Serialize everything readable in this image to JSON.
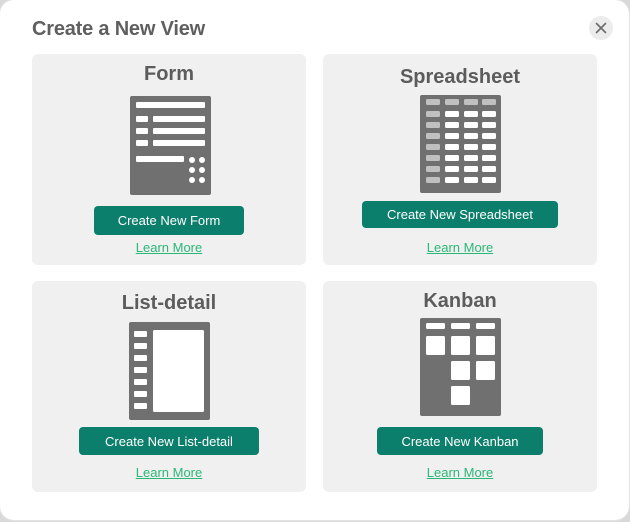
{
  "dialog": {
    "title": "Create a New View",
    "close_icon": "close-icon"
  },
  "cards": {
    "form": {
      "title": "Form",
      "button_label": "Create New Form",
      "learn_more": "Learn More",
      "icon": "form-illustration-icon"
    },
    "spreadsheet": {
      "title": "Spreadsheet",
      "button_label": "Create New Spreadsheet",
      "learn_more": "Learn More",
      "icon": "spreadsheet-illustration-icon"
    },
    "list_detail": {
      "title": "List-detail",
      "button_label": "Create New List-detail",
      "learn_more": "Learn More",
      "icon": "list-detail-illustration-icon"
    },
    "kanban": {
      "title": "Kanban",
      "button_label": "Create New Kanban",
      "learn_more": "Learn More",
      "icon": "kanban-illustration-icon"
    }
  },
  "colors": {
    "accent": "#0c7f6c",
    "link": "#2ab777",
    "card_background": "#f0f0f0",
    "illustration": "#707070"
  }
}
